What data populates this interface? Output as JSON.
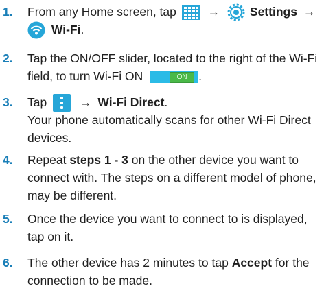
{
  "steps": [
    {
      "number": "1.",
      "lines": [
        {
          "prefix": "From any Home screen, tap",
          "arrow1": "→",
          "settings": "Settings",
          "arrow2": "→"
        },
        {
          "wifi": "Wi-Fi",
          "end": "."
        }
      ]
    },
    {
      "number": "2.",
      "lines": [
        {
          "text": "Tap the ON/OFF slider, located to the right of the Wi-Fi"
        },
        {
          "text": "field, to turn Wi-Fi ON",
          "toggle_label": "ON",
          "end": "."
        }
      ]
    },
    {
      "number": "3.",
      "lines": [
        {
          "prefix": "Tap",
          "arrow": "→",
          "target": "Wi-Fi Direct",
          "end": "."
        },
        {
          "text": "Your phone automatically scans for other Wi-Fi Direct"
        },
        {
          "text": "devices."
        }
      ]
    },
    {
      "number": "4.",
      "lines": [
        {
          "prefix": "Repeat",
          "bold": "steps 1 - 3",
          "suffix": "on the other device you want to"
        },
        {
          "text": "connect with. The steps on a different model of phone,"
        },
        {
          "text": "may be different."
        }
      ]
    },
    {
      "number": "5.",
      "lines": [
        {
          "text": "Once the device you want to connect to is displayed,"
        },
        {
          "text": "tap on it."
        }
      ]
    },
    {
      "number": "6.",
      "lines": [
        {
          "prefix": "The other device has 2 minutes to tap",
          "bold": "Accept",
          "suffix": "for the"
        },
        {
          "text": "connection to be made."
        }
      ]
    }
  ],
  "icons": {
    "apps": "apps-grid-icon",
    "settings": "settings-gear-icon",
    "wifi": "wifi-icon",
    "menu": "menu-icon"
  },
  "colors": {
    "step_number": "#1a7fb8",
    "icon_blue": "#26a6d8",
    "toggle_on": "#4ab948"
  }
}
